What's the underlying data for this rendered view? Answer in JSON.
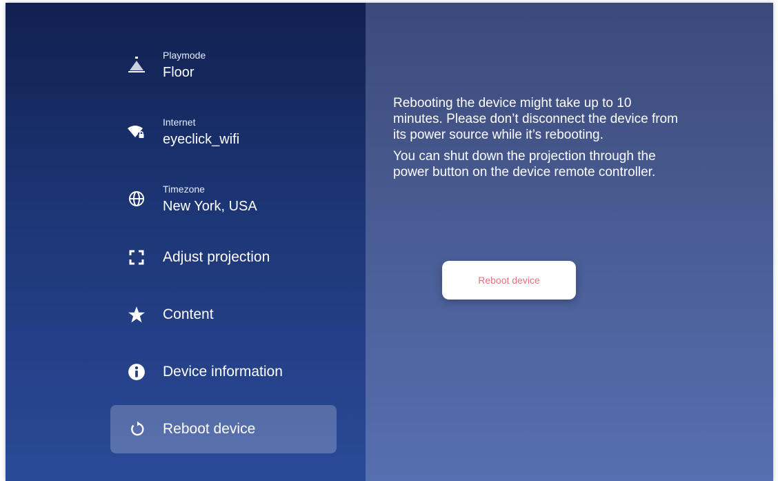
{
  "sidebar": {
    "items": [
      {
        "label": "Playmode",
        "value": "Floor",
        "icon": "playmode-icon"
      },
      {
        "label": "Internet",
        "value": "eyeclick_wifi",
        "icon": "wifi-lock-icon"
      },
      {
        "label": "Timezone",
        "value": "New York, USA",
        "icon": "globe-icon"
      },
      {
        "label": "Adjust projection",
        "icon": "frame-corners-icon"
      },
      {
        "label": "Content",
        "icon": "star-icon"
      },
      {
        "label": "Device information",
        "icon": "info-icon"
      },
      {
        "label": "Reboot device",
        "icon": "reboot-icon",
        "active": true
      }
    ]
  },
  "main": {
    "paragraphs": [
      "Rebooting the device might take up to 10 minutes. Please don’t disconnect the device from its power source while it’s rebooting.",
      "You can shut down the projection through the power button on the device remote controller."
    ],
    "button_label": "Reboot device"
  },
  "colors": {
    "accent_text": "#e9707f",
    "sidebar_top": "#10204f",
    "sidebar_bottom": "#2a4a98"
  }
}
